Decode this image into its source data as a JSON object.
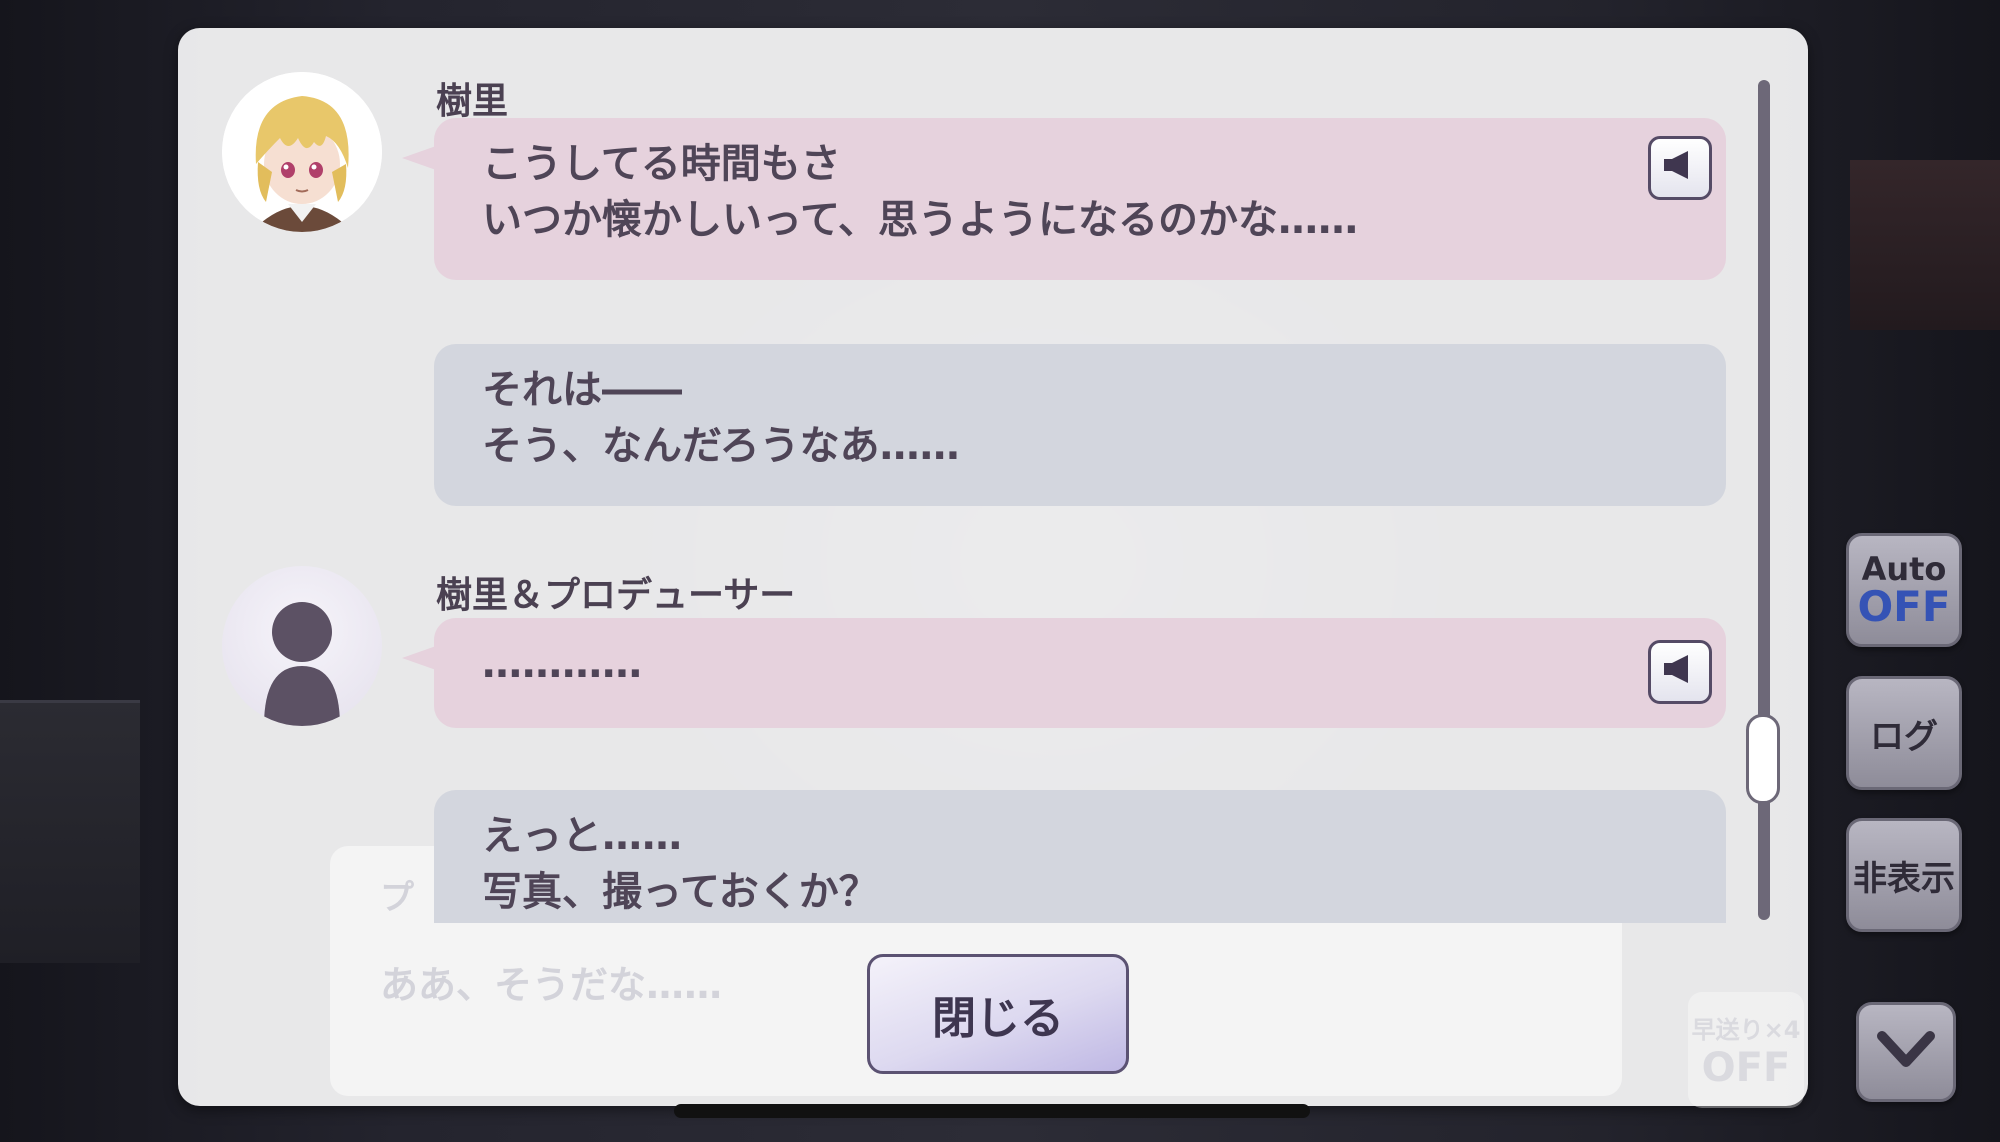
{
  "messages": [
    {
      "speaker": "樹里",
      "line1": "こうしてる時間もさ",
      "line2": "いつか懐かしいって、思うようになるのかな……",
      "voice_icon": "speaker-icon"
    },
    {
      "speaker": "",
      "line1": "それは――",
      "line2": "そう、なんだろうなあ……"
    },
    {
      "speaker": "樹里＆プロデューサー",
      "line1": "…………",
      "voice_icon": "speaker-icon"
    },
    {
      "speaker": "",
      "line1": "えっと……",
      "line2": "写真、撮っておくか？"
    }
  ],
  "background_dialog": {
    "speaker": "プ",
    "text": "ああ、そうだな……"
  },
  "close_label": "閉じる",
  "controls": {
    "auto_label": "Auto",
    "auto_state": "OFF",
    "log_label": "ログ",
    "hide_label": "非表示",
    "fast_forward_label": "早送り×4",
    "fast_forward_state": "OFF"
  },
  "colors": {
    "pink_bubble": "#e6d2dd",
    "gray_bubble": "#d3d6de",
    "accent_blue": "#3553b5"
  }
}
